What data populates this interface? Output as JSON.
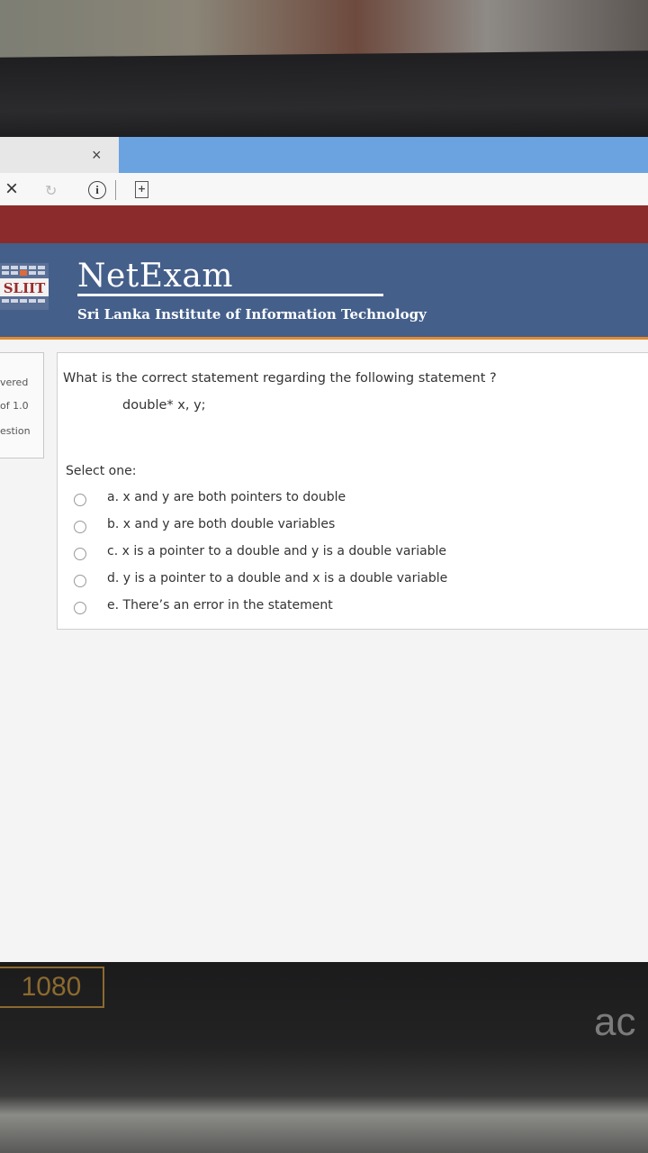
{
  "browser": {
    "tab_close": "×",
    "stop": "×",
    "reload": "↻",
    "info": "i",
    "page": "+"
  },
  "header": {
    "logo_text": "SLIIT",
    "title": "NetExam",
    "subtitle": "Sri Lanka Institute of Information Technology"
  },
  "sidebar": {
    "lines": [
      "vered",
      "of 1.0",
      "estion"
    ]
  },
  "question": {
    "text": "What is the correct statement regarding the following statement ?",
    "code": "double* x, y;",
    "select_label": "Select one:",
    "options": [
      "a. x and y are both pointers to double",
      "b. x and y are both double variables",
      "c. x is a pointer to a double and y is a double variable",
      "d. y is a pointer to a double and x is a double variable",
      "e. There’s an error in the statement"
    ]
  },
  "monitor": {
    "resolution": "1080",
    "brand": "ac"
  },
  "colors": {
    "header_bg": "#445f8a",
    "header_accent": "#e48a2f",
    "maroon_bar": "#8c2b2b",
    "tab_blue": "#6aa3e0"
  }
}
